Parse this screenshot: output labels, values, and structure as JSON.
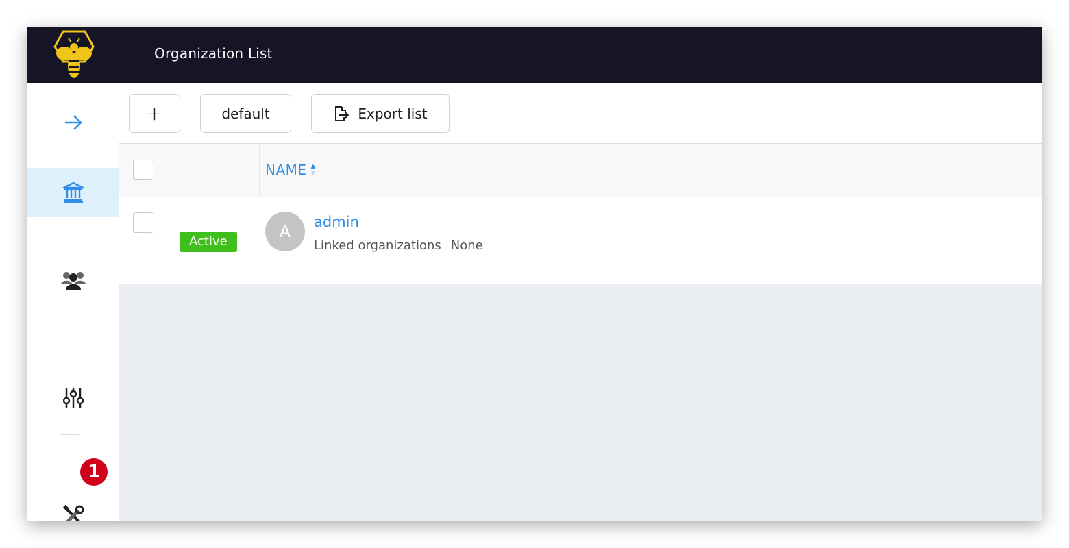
{
  "header": {
    "title": "Organization List",
    "logo_icon": "bee-logo-icon",
    "background": "#161528"
  },
  "sidebar": {
    "items": [
      {
        "name": "expand",
        "icon": "arrow-right-icon",
        "active": false
      },
      {
        "name": "organizations",
        "icon": "bank-icon",
        "active": true
      },
      {
        "name": "users",
        "icon": "users-icon",
        "active": false
      },
      {
        "name": "settings",
        "icon": "sliders-icon",
        "active": false
      },
      {
        "name": "tools",
        "icon": "tools-icon",
        "active": false
      }
    ],
    "tools_badge": "1"
  },
  "toolbar": {
    "add_label": "+",
    "profile_label": "default",
    "export_label": "Export list"
  },
  "table": {
    "columns": [
      {
        "label": "NAME",
        "sort": "ascending"
      }
    ],
    "rows": [
      {
        "status": "Active",
        "avatar_letter": "A",
        "name": "admin",
        "linked_label": "Linked organizations",
        "linked_value": "None"
      }
    ]
  },
  "colors": {
    "accent": "#2f8fe8",
    "active_status": "#3fbf1c",
    "badge": "#d0021b",
    "logo": "#f0c419"
  }
}
